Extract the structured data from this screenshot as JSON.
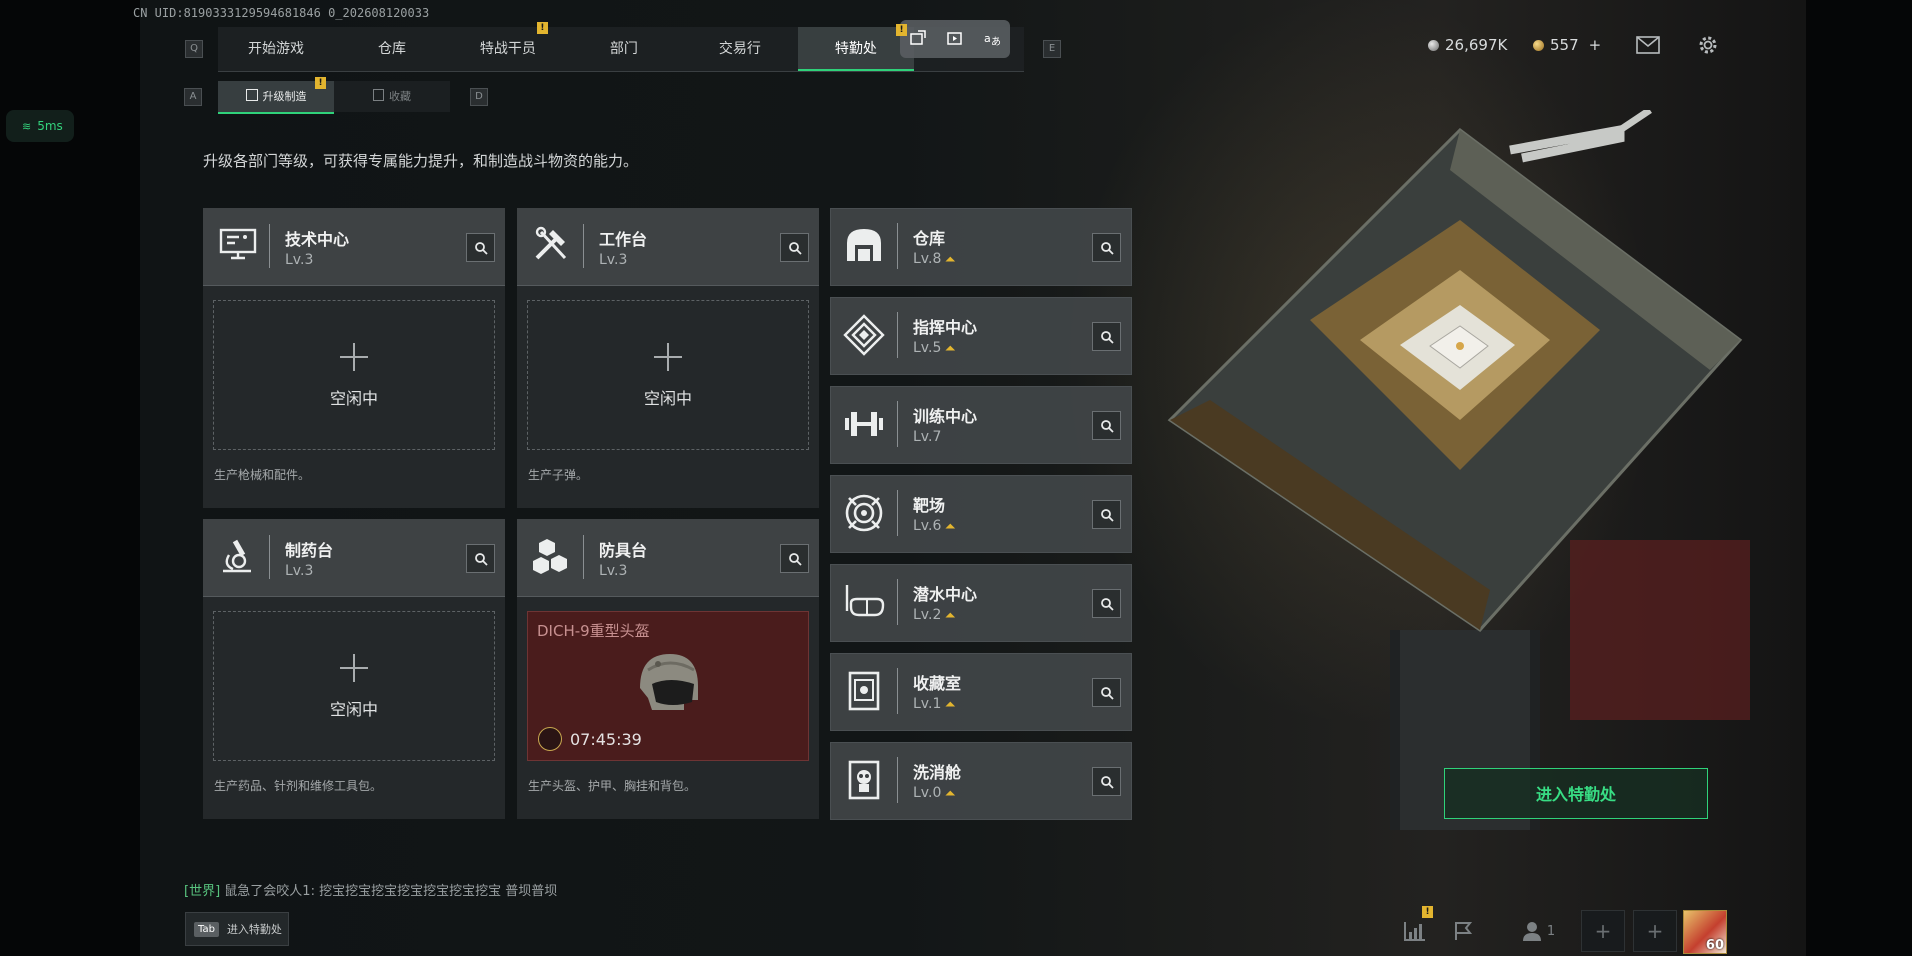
{
  "header": {
    "uid": "CN UID:8190333129594681846 0_202608120033",
    "left_key": "Q",
    "right_key": "E",
    "tabs": [
      {
        "label": "开始游戏"
      },
      {
        "label": "仓库"
      },
      {
        "label": "特战干员",
        "badge": "!"
      },
      {
        "label": "部门"
      },
      {
        "label": "交易行"
      },
      {
        "label": "特勤处",
        "active": true
      }
    ],
    "currency": [
      {
        "icon": "silver-coin-icon",
        "value": "26,697K"
      },
      {
        "icon": "gold-coin-icon",
        "value": "557",
        "add": "+"
      }
    ]
  },
  "subnav": {
    "left_key": "A",
    "right_key": "D",
    "tabs": [
      {
        "label": "升级制造",
        "active": true,
        "badge": "!"
      },
      {
        "label": "收藏"
      }
    ]
  },
  "ping": "5ms",
  "description": "升级各部门等级，可获得专属能力提升，和制造战斗物资的能力。",
  "production_cards": [
    {
      "name": "技术中心",
      "level": "Lv.3",
      "icon": "computer-icon",
      "state": "idle",
      "idle_label": "空闲中",
      "footer": "生产枪械和配件。"
    },
    {
      "name": "工作台",
      "level": "Lv.3",
      "icon": "tools-icon",
      "state": "idle",
      "idle_label": "空闲中",
      "footer": "生产子弹。"
    },
    {
      "name": "制药台",
      "level": "Lv.3",
      "icon": "microscope-icon",
      "state": "idle",
      "idle_label": "空闲中",
      "footer": "生产药品、针剂和维修工具包。"
    },
    {
      "name": "防具台",
      "level": "Lv.3",
      "icon": "cubes-icon",
      "state": "crafting",
      "item_name": "DICH-9重型头盔",
      "timer": "07:45:39",
      "footer": "生产头盔、护甲、胸挂和背包。"
    }
  ],
  "facilities": [
    {
      "name": "仓库",
      "level": "Lv.8",
      "icon": "warehouse-icon",
      "upgradable": true
    },
    {
      "name": "指挥中心",
      "level": "Lv.5",
      "icon": "command-icon",
      "upgradable": true
    },
    {
      "name": "训练中心",
      "level": "Lv.7",
      "icon": "dumbbell-icon",
      "upgradable": false
    },
    {
      "name": "靶场",
      "level": "Lv.6",
      "icon": "target-icon",
      "upgradable": true
    },
    {
      "name": "潜水中心",
      "level": "Lv.2",
      "icon": "diving-mask-icon",
      "upgradable": true
    },
    {
      "name": "收藏室",
      "level": "Lv.1",
      "icon": "collection-icon",
      "upgradable": true
    },
    {
      "name": "洗消舱",
      "level": "Lv.0",
      "icon": "gas-mask-icon",
      "upgradable": true
    }
  ],
  "enter_button": "进入特勤处",
  "chat": {
    "channel": "[世界]",
    "message": "鼠急了会咬人1: 挖宝挖宝挖宝挖宝挖宝挖宝挖宝 普坝普坝"
  },
  "tab_hint": {
    "key": "Tab",
    "label": "进入特勤处"
  },
  "bottom_bar": {
    "party_count": "1",
    "avatar_level": "60"
  },
  "colors": {
    "accent": "#2fd27a",
    "warn": "#e3b52f"
  }
}
